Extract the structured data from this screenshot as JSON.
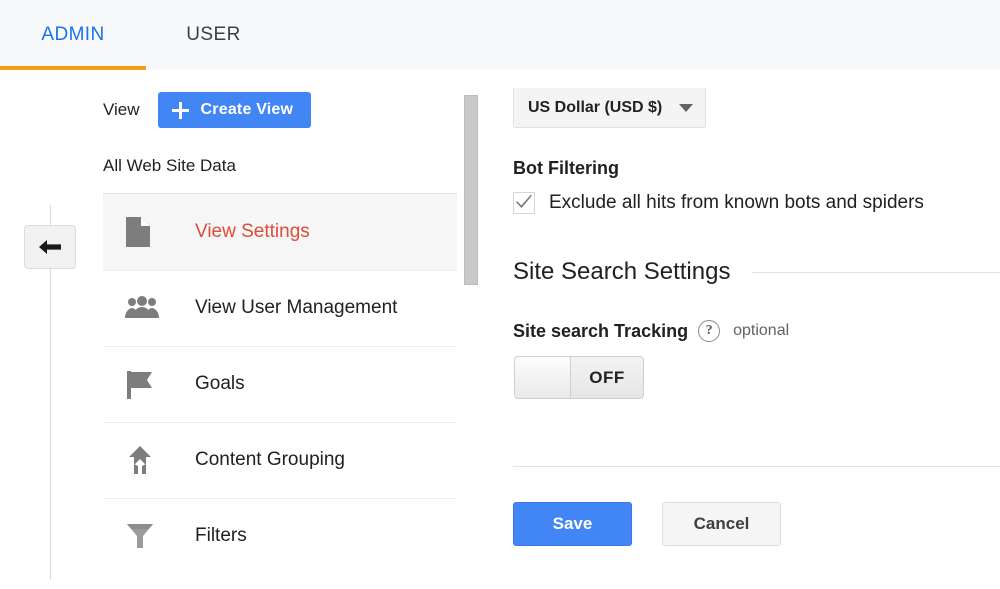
{
  "tabs": {
    "admin_label": "ADMIN",
    "user_label": "USER",
    "active": "ADMIN",
    "active_color": "#1a73e8",
    "underline_color": "#f69c19"
  },
  "rail": {
    "collapse_icon": "arrow-left-icon"
  },
  "view_panel": {
    "view_label": "View",
    "create_button_label": "Create View",
    "create_button_icon": "plus-icon",
    "create_button_color": "#4285f4",
    "profile_name": "All Web Site Data",
    "menu_items": [
      {
        "label": "View Settings",
        "icon": "document-icon",
        "active": true
      },
      {
        "label": "View User Management",
        "icon": "people-icon",
        "active": false
      },
      {
        "label": "Goals",
        "icon": "flag-icon",
        "active": false
      },
      {
        "label": "Content Grouping",
        "icon": "merge-arrow-icon",
        "active": false
      },
      {
        "label": "Filters",
        "icon": "funnel-icon",
        "active": false
      }
    ],
    "active_item_color": "#dd4b39"
  },
  "settings_panel": {
    "currency": {
      "value": "US Dollar (USD $)",
      "caret_icon": "chevron-down-icon"
    },
    "bot_filtering": {
      "heading": "Bot Filtering",
      "checkbox_label": "Exclude all hits from known bots and spiders",
      "checked": true,
      "check_icon": "checkmark-icon"
    },
    "site_search": {
      "section_title": "Site Search Settings",
      "field_label": "Site search Tracking",
      "help_icon": "help-question-icon",
      "help_glyph": "?",
      "optional_label": "optional",
      "toggle_state": "OFF"
    },
    "actions": {
      "save_label": "Save",
      "cancel_label": "Cancel"
    }
  }
}
